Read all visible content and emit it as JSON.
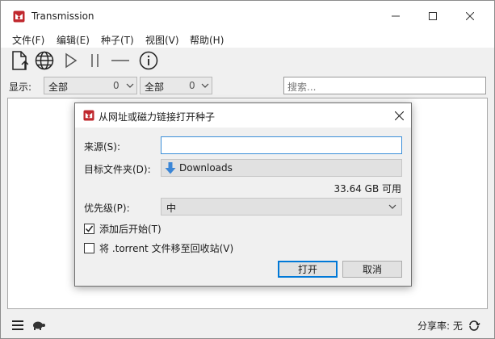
{
  "window": {
    "title": "Transmission"
  },
  "menu": [
    {
      "label": "文件(F)"
    },
    {
      "label": "编辑(E)"
    },
    {
      "label": "种子(T)"
    },
    {
      "label": "视图(V)"
    },
    {
      "label": "帮助(H)"
    }
  ],
  "toolbar": {
    "icons": [
      "new-file-icon",
      "globe-icon",
      "play-icon",
      "pause-icon",
      "remove-icon",
      "info-icon"
    ]
  },
  "filter": {
    "label": "显示:",
    "status": {
      "value": "全部",
      "count": "0"
    },
    "tracker": {
      "value": "全部",
      "count": "0"
    },
    "search_placeholder": "搜索..."
  },
  "statusbar": {
    "ratio_label": "分享率: 无"
  },
  "dialog": {
    "title": "从网址或磁力链接打开种子",
    "source_label": "来源(S):",
    "source_value": "",
    "dest_label": "目标文件夹(D):",
    "dest_value": "Downloads",
    "free_space": "33.64 GB 可用",
    "priority_label": "优先级(P):",
    "priority_value": "中",
    "start_when_added": {
      "label": "添加后开始(T)",
      "checked": true
    },
    "trash_torrent": {
      "label": "将 .torrent 文件移至回收站(V)",
      "checked": false
    },
    "ok_label": "打开",
    "cancel_label": "取消"
  },
  "colors": {
    "accent": "#0078d7",
    "folder_icon": "#3b86d6",
    "app_icon": "#c0282e"
  }
}
